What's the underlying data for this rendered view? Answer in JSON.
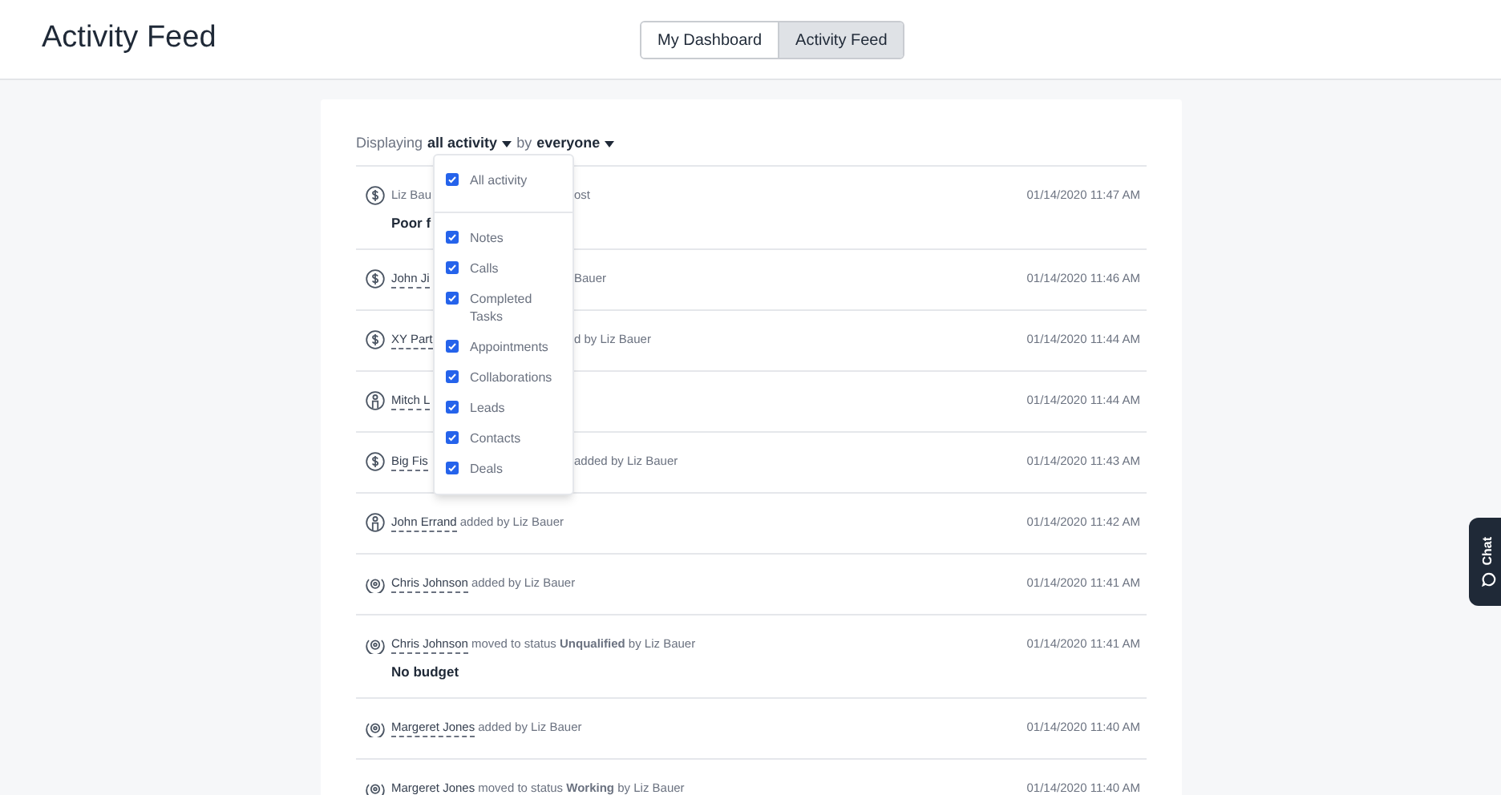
{
  "header": {
    "title": "Activity Feed"
  },
  "tabs": [
    {
      "label": "My Dashboard",
      "selected": false
    },
    {
      "label": "Activity Feed",
      "selected": true
    }
  ],
  "filter": {
    "prefix": "Displaying",
    "activity": "all activity",
    "by": "by",
    "who": "everyone"
  },
  "filter_menu": [
    {
      "label": "All activity",
      "checked": true
    },
    {
      "label": "Notes",
      "checked": true
    },
    {
      "label": "Calls",
      "checked": true
    },
    {
      "label": "Completed Tasks",
      "checked": true
    },
    {
      "label": "Appointments",
      "checked": true
    },
    {
      "label": "Collaborations",
      "checked": true
    },
    {
      "label": "Leads",
      "checked": true
    },
    {
      "label": "Contacts",
      "checked": true
    },
    {
      "label": "Deals",
      "checked": true
    }
  ],
  "feed": [
    {
      "kind": "deal",
      "text": "Liz Bau",
      "tail": "ost",
      "note": "Poor f",
      "time": "01/14/2020 11:47 AM"
    },
    {
      "kind": "deal",
      "name": "John Ji",
      "tail": "Bauer",
      "time": "01/14/2020 11:46 AM"
    },
    {
      "kind": "deal",
      "name": "XY Part",
      "tail": "d by Liz Bauer",
      "time": "01/14/2020 11:44 AM"
    },
    {
      "kind": "lead",
      "name": "Mitch L",
      "time": "01/14/2020 11:44 AM"
    },
    {
      "kind": "deal",
      "name": "Big Fis",
      "tail": "added by Liz Bauer",
      "time": "01/14/2020 11:43 AM"
    },
    {
      "kind": "lead",
      "name": "John Errand",
      "text": "added by Liz Bauer",
      "time": "01/14/2020 11:42 AM"
    },
    {
      "kind": "contact",
      "name": "Chris Johnson",
      "text": "added by Liz Bauer",
      "time": "01/14/2020 11:41 AM"
    },
    {
      "kind": "contact",
      "name": "Chris Johnson",
      "text": "moved to status **Unqualified** by Liz Bauer",
      "note": "No budget",
      "time": "01/14/2020 11:41 AM"
    },
    {
      "kind": "contact",
      "name": "Margeret Jones",
      "text": "added by Liz Bauer",
      "time": "01/14/2020 11:40 AM"
    },
    {
      "kind": "contact",
      "name": "Margeret Jones",
      "text": "moved to status **Working** by Liz Bauer",
      "time": "01/14/2020 11:40 AM"
    }
  ],
  "chat": {
    "label": "Chat"
  }
}
